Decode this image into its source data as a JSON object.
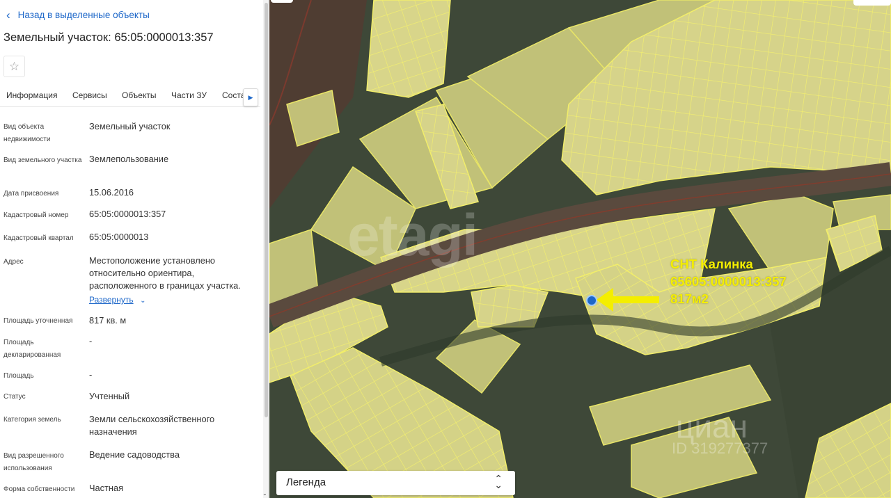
{
  "panel": {
    "back_label": "Назад в выделенные объекты",
    "title": "Земельный участок: 65:05:0000013:357",
    "star_icon": "star-outline",
    "tabs": [
      "Информация",
      "Сервисы",
      "Объекты",
      "Части ЗУ",
      "Соста"
    ],
    "active_tab": "Информация",
    "expand_label": "Развернуть",
    "rows": [
      {
        "label": "Вид объекта недвижимости",
        "value": "Земельный участок"
      },
      {
        "label": "Вид земельного участка",
        "value": "Землепользование"
      },
      {
        "label": "Дата присвоения",
        "value": "15.06.2016"
      },
      {
        "label": "Кадастровый номер",
        "value": "65:05:0000013:357"
      },
      {
        "label": "Кадастровый квартал",
        "value": "65:05:0000013"
      },
      {
        "label": "Адрес",
        "value": "Местоположение установлено относительно ориентира, расположенного в границах участка."
      },
      {
        "label": "Площадь уточненная",
        "value": "817 кв. м"
      },
      {
        "label": "Площадь декларированная",
        "value": "-"
      },
      {
        "label": "Площадь",
        "value": "-"
      },
      {
        "label": "Статус",
        "value": "Учтенный"
      },
      {
        "label": "Категория земель",
        "value": "Земли сельскохозяйственного назначения"
      },
      {
        "label": "Вид разрешенного использования",
        "value": "Ведение садоводства"
      },
      {
        "label": "Форма собственности",
        "value": "Частная"
      }
    ]
  },
  "map": {
    "legend_label": "Легенда",
    "annotation": [
      "СНТ Калинка",
      "65605:0000013:357",
      "817м2"
    ],
    "watermarks": [
      "etagi",
      "циан",
      "ID 319277377"
    ],
    "colors": {
      "parcel_fill": "#dcd98a",
      "parcel_stroke": "#f2ee6a",
      "annotation": "#f4ee00",
      "arrow": "#f4ee00",
      "marker": "#1d67c9",
      "ground": "#3f4a3a"
    }
  }
}
